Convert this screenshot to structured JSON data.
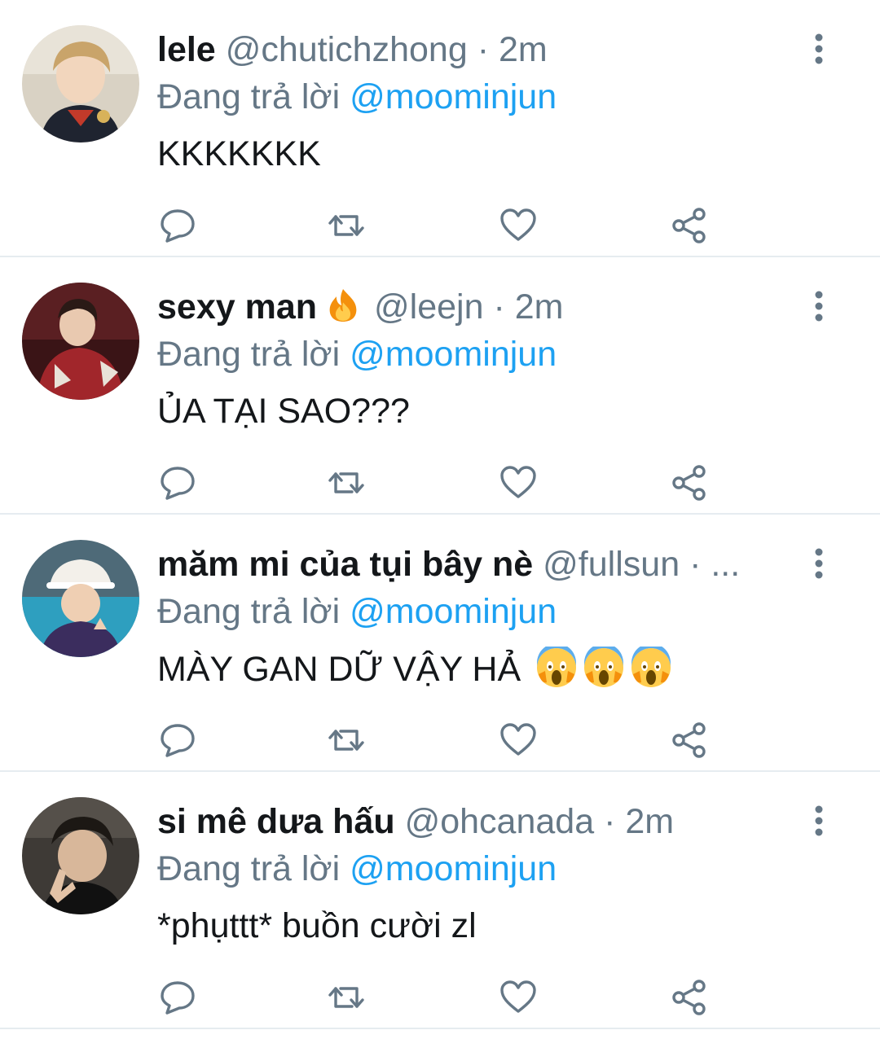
{
  "reply_prefix": "Đang trả lời",
  "colors": {
    "accent": "#1da1f2",
    "secondary_text": "#657786",
    "primary_text": "#14171a",
    "divider": "#e6ecf0"
  },
  "tweets": [
    {
      "name": "lele",
      "handle": "@chutichzhong",
      "separator": "·",
      "time": "2m",
      "reply_to": "@moominjun",
      "text": "KKKKKKK",
      "avatar_icon": "profile-photo"
    },
    {
      "name": "sexy man",
      "name_emoji": "fire-emoji",
      "handle": "@leejn",
      "separator": "·",
      "time": "2m",
      "reply_to": "@moominjun",
      "text": "ỦA TẠI SAO???",
      "avatar_icon": "profile-photo"
    },
    {
      "name": "măm mi của tụi bây nè",
      "handle": "@fullsun",
      "separator": "·",
      "time": "...",
      "reply_to": "@moominjun",
      "text": "MÀY GAN DỮ VẬY HẢ",
      "text_emojis": [
        "screaming-face-emoji",
        "screaming-face-emoji",
        "screaming-face-emoji"
      ],
      "avatar_icon": "profile-photo"
    },
    {
      "name": "si mê dưa hấu",
      "handle": "@ohcanada",
      "separator": "·",
      "time": "2m",
      "reply_to": "@moominjun",
      "text": "*phụttt* buồn cười zl",
      "avatar_icon": "profile-photo"
    }
  ],
  "action_icons": [
    "reply-icon",
    "retweet-icon",
    "like-icon",
    "share-icon"
  ]
}
